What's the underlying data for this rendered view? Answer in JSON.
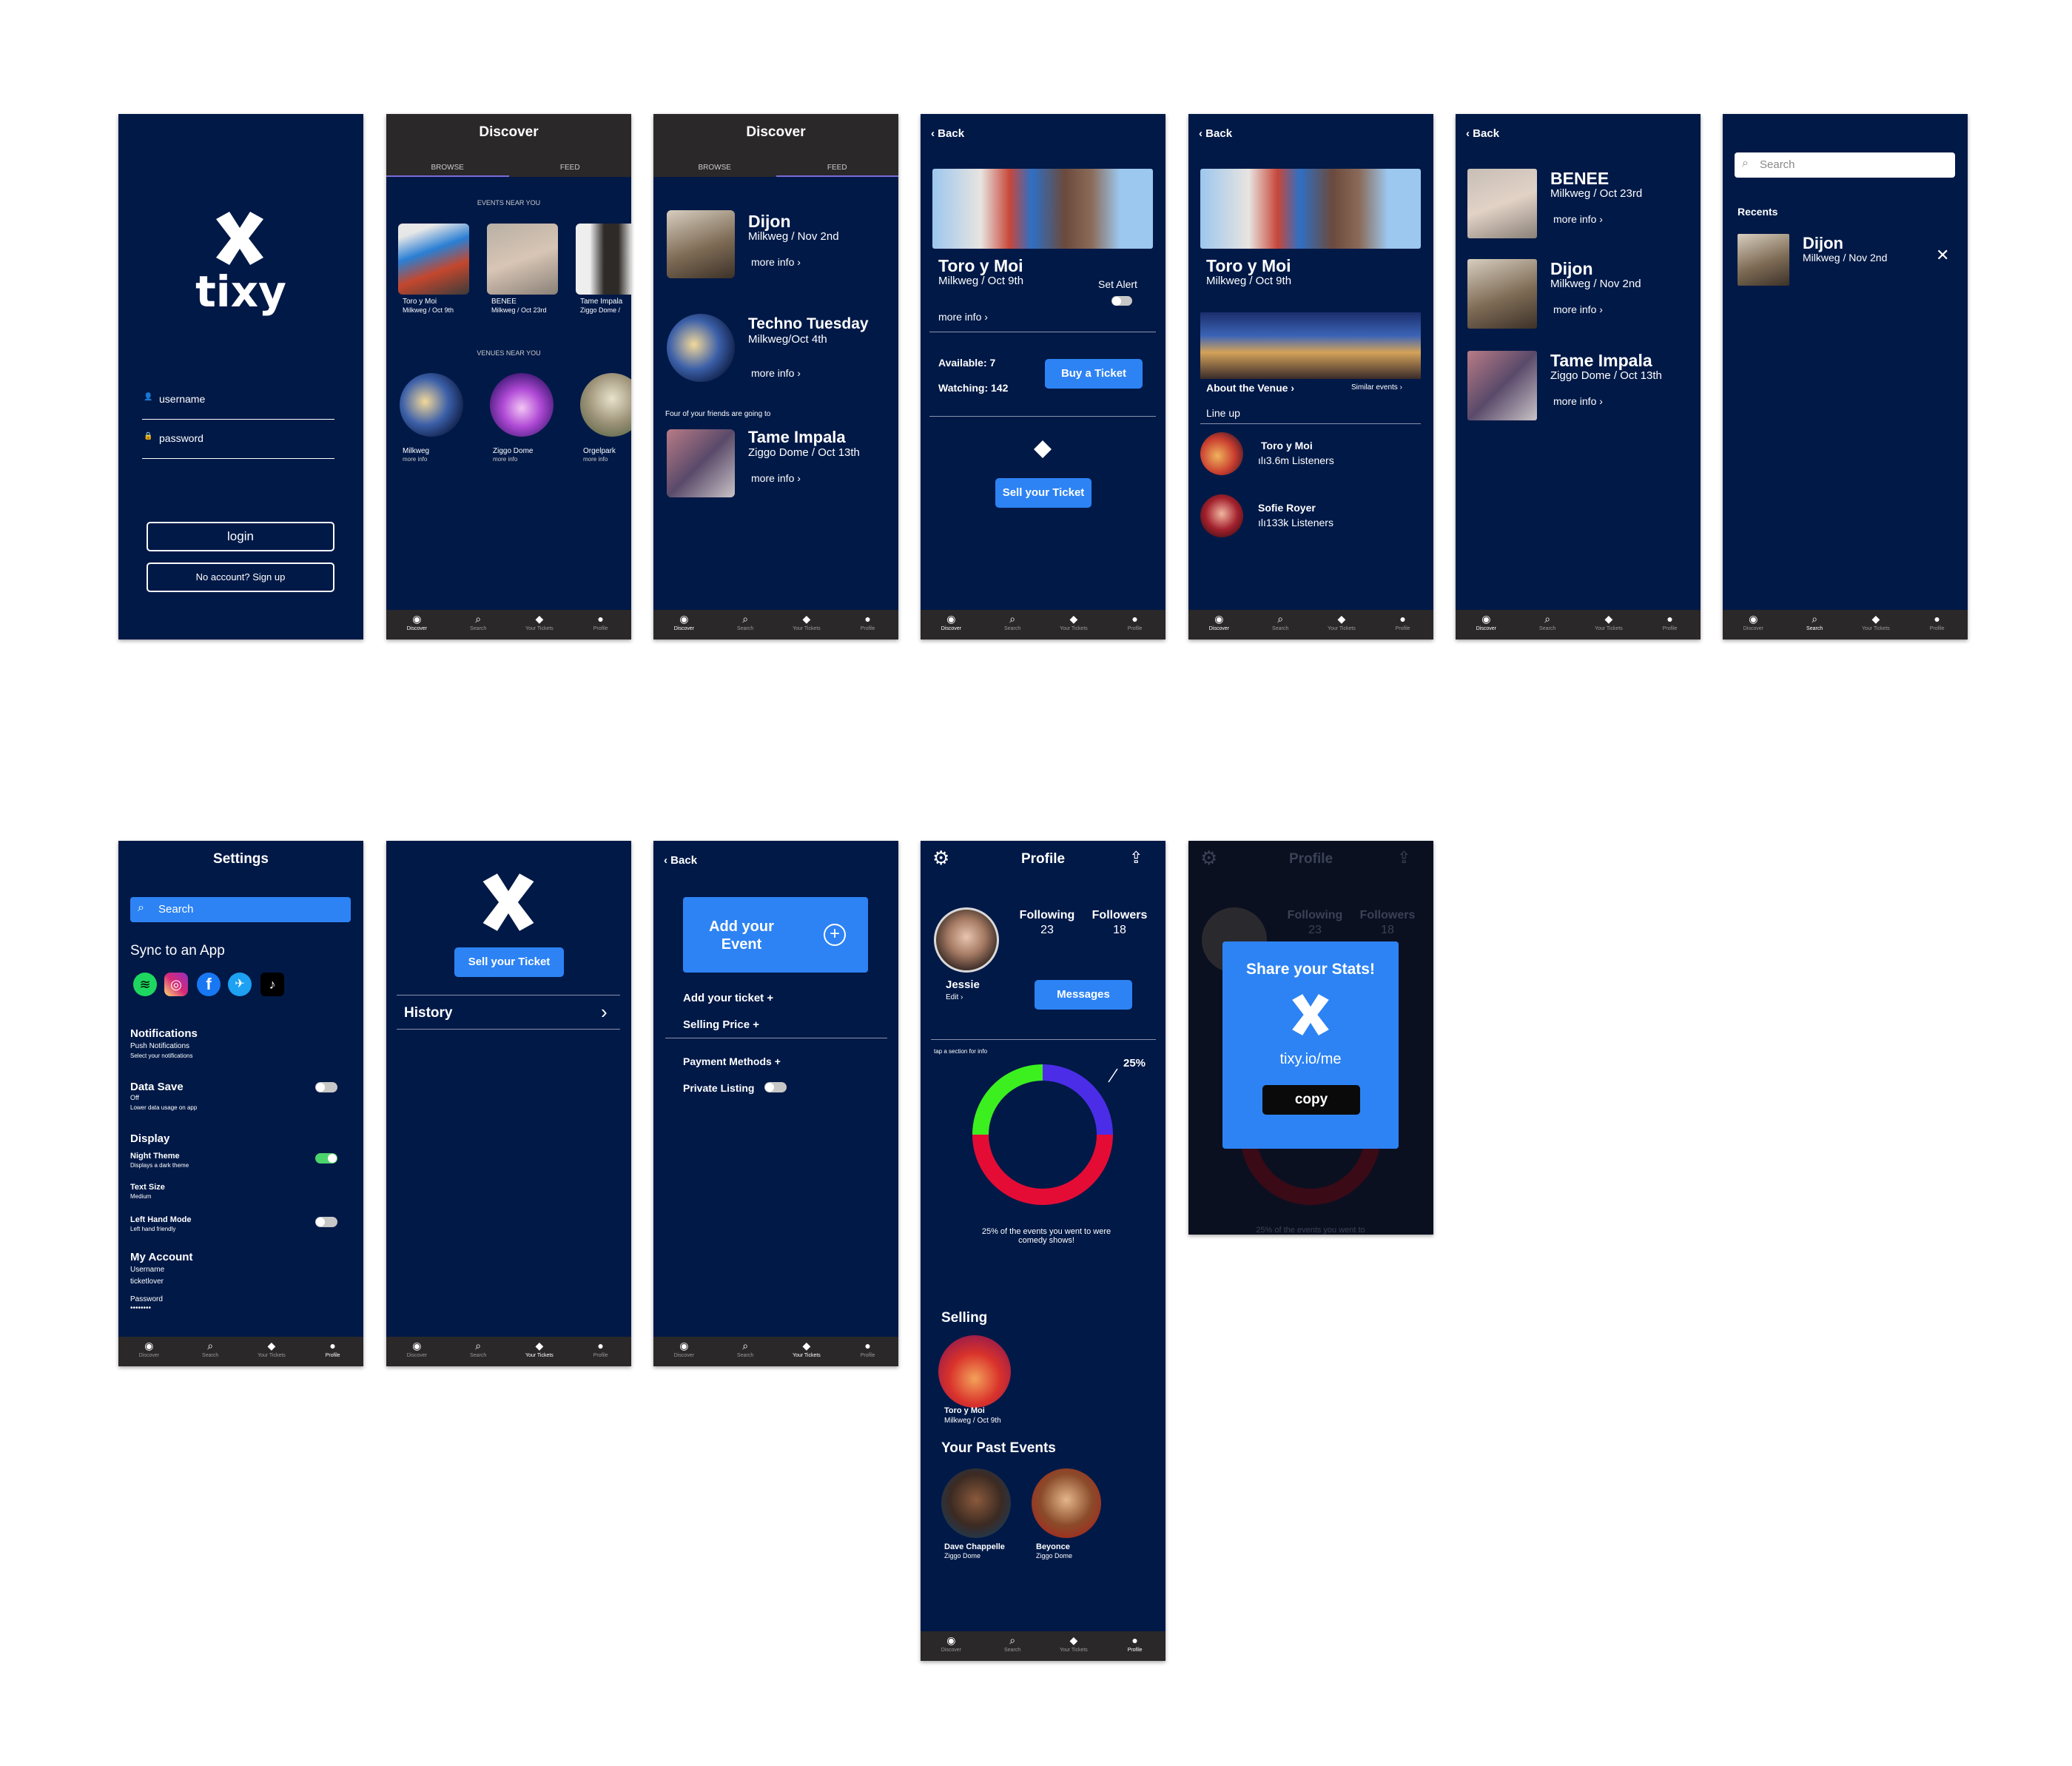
{
  "brand": "tixy",
  "nav": [
    "Discover",
    "Search",
    "Your Tickets",
    "Profile"
  ],
  "s1": {
    "username": "username",
    "password": "password",
    "login": "login",
    "signup": "No account? Sign up"
  },
  "s2": {
    "title": "Discover",
    "tab1": "BROWSE",
    "tab2": "FEED",
    "events_head": "EVENTS NEAR YOU",
    "venues_head": "VENUES NEAR YOU",
    "events": [
      {
        "name": "Toro y Moi",
        "sub": "Milkweg / Oct 9th"
      },
      {
        "name": "BENEE",
        "sub": "Milkweg / Oct 23rd"
      },
      {
        "name": "Tame Impala",
        "sub": "Ziggo Dome /"
      }
    ],
    "venues": [
      {
        "name": "Milkweg",
        "sub": "more info"
      },
      {
        "name": "Ziggo Dome",
        "sub": "more info"
      },
      {
        "name": "Orgelpark",
        "sub": "more info"
      }
    ]
  },
  "s3": {
    "title": "Discover",
    "tab1": "BROWSE",
    "tab2": "FEED",
    "items": [
      {
        "name": "Dijon",
        "sub": "Milkweg / Nov 2nd",
        "more": "more info"
      },
      {
        "name": "Techno Tuesday",
        "sub": "Milkweg/Oct 4th",
        "more": "more info"
      },
      {
        "name": "Tame Impala",
        "sub": "Ziggo Dome / Oct 13th",
        "more": "more info"
      }
    ],
    "friends": "Four of your friends are going to"
  },
  "s4": {
    "back": "Back",
    "name": "Toro y Moi",
    "sub": "Milkweg / Oct 9th",
    "alert": "Set Alert",
    "more": "more info",
    "available": "Available: 7",
    "watching": "Watching: 142",
    "buy": "Buy a Ticket",
    "sell": "Sell your Ticket"
  },
  "s5": {
    "back": "Back",
    "name": "Toro y Moi",
    "sub": "Milkweg / Oct 9th",
    "about": "About the Venue",
    "similar": "Similar events",
    "lineup": "Line up",
    "artists": [
      {
        "name": "Toro y Moi",
        "listeners": "3.6m Listeners"
      },
      {
        "name": "Sofie Royer",
        "listeners": "133k Listeners"
      }
    ]
  },
  "s6": {
    "back": "Back",
    "items": [
      {
        "name": "BENEE",
        "sub": "Milkweg / Oct 23rd",
        "more": "more info"
      },
      {
        "name": "Dijon",
        "sub": "Milkweg / Nov 2nd",
        "more": "more info"
      },
      {
        "name": "Tame Impala",
        "sub": "Ziggo Dome / Oct 13th",
        "more": "more info"
      }
    ]
  },
  "s7": {
    "search": "Search",
    "recents": "Recents",
    "item": {
      "name": "Dijon",
      "sub": "Milkweg / Nov 2nd"
    }
  },
  "s8": {
    "title": "Settings",
    "search": "Search",
    "sync": "Sync to an App",
    "notif": "Notifications",
    "push": "Push Notifications",
    "push_sub": "Select your notifications",
    "datasave": "Data Save",
    "datasave_v": "Off",
    "datasave_sub": "Lower data usage on app",
    "display": "Display",
    "night": "Night Theme",
    "night_sub": "Displays a dark theme",
    "textsize": "Text Size",
    "textsize_v": "Medium",
    "lefthand": "Left Hand Mode",
    "lefthand_sub": "Left hand friendly",
    "account": "My Account",
    "username_l": "Username",
    "username_v": "ticketlover",
    "password_l": "Password",
    "password_v": "••••••••"
  },
  "s9": {
    "sell": "Sell your Ticket",
    "history": "History"
  },
  "s10": {
    "back": "Back",
    "add": "Add your Event",
    "addticket": "Add your ticket +",
    "price": "Selling Price +",
    "payment": "Payment Methods +",
    "private": "Private Listing"
  },
  "s11": {
    "title": "Profile",
    "following": "Following",
    "following_n": "23",
    "followers": "Followers",
    "followers_n": "18",
    "user": "Jessie",
    "edit": "Edit",
    "messages": "Messages",
    "tap": "tap a section for info",
    "pct": "25%",
    "caption": "25% of the events you went to were comedy shows!",
    "selling": "Selling",
    "sell_item": {
      "name": "Toro y Moi",
      "sub": "Milkweg / Oct 9th"
    },
    "past": "Your Past Events",
    "past_items": [
      {
        "name": "Dave Chappelle",
        "sub": "Ziggo Dome"
      },
      {
        "name": "Beyonce",
        "sub": "Ziggo Dome"
      }
    ]
  },
  "s12": {
    "title": "Profile",
    "following": "Following",
    "following_n": "23",
    "followers": "Followers",
    "followers_n": "18",
    "share": "Share your Stats!",
    "url": "tixy.io/me",
    "copy": "copy",
    "caption": "25% of the events you went to"
  },
  "colors": {
    "bg": "#011947",
    "accent": "#2d83f4",
    "bar": "#2b2829"
  }
}
